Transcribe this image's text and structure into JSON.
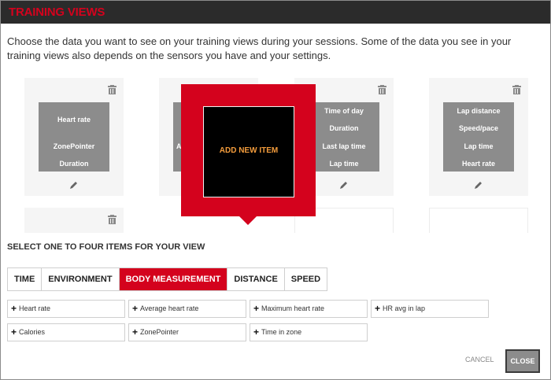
{
  "header": {
    "title": "TRAINING VIEWS"
  },
  "intro": "Choose the data you want to see on your training views during your sessions. Some of the data you see in your training views also depends on the sensors you have and your settings.",
  "views": [
    {
      "items": [
        "Heart rate",
        "ZonePointer",
        "Duration"
      ]
    },
    {
      "items": [
        "A"
      ]
    },
    {
      "items": [
        "Time of day",
        "Duration",
        "Last lap time",
        "Lap time"
      ]
    },
    {
      "items": [
        "Lap distance",
        "Speed/pace",
        "Lap time",
        "Heart rate"
      ]
    }
  ],
  "popup": {
    "label": "ADD NEW ITEM"
  },
  "selector": {
    "heading": "SELECT ONE TO FOUR ITEMS FOR YOUR VIEW",
    "tabs": [
      "TIME",
      "ENVIRONMENT",
      "BODY MEASUREMENT",
      "DISTANCE",
      "SPEED"
    ],
    "active_tab": "BODY MEASUREMENT",
    "items": [
      "Heart rate",
      "Average heart rate",
      "Maximum heart rate",
      "HR avg in lap",
      "Calories",
      "ZonePointer",
      "Time in zone"
    ]
  },
  "footer": {
    "cancel": "CANCEL",
    "close": "CLOSE"
  },
  "colors": {
    "accent": "#d4021d",
    "titlebar": "#2b2b2b",
    "tile": "#8c8c8c",
    "add_label": "#f39c3c"
  },
  "icons": {
    "delete": "trash-icon",
    "edit": "pencil-icon",
    "add": "plus-icon"
  }
}
